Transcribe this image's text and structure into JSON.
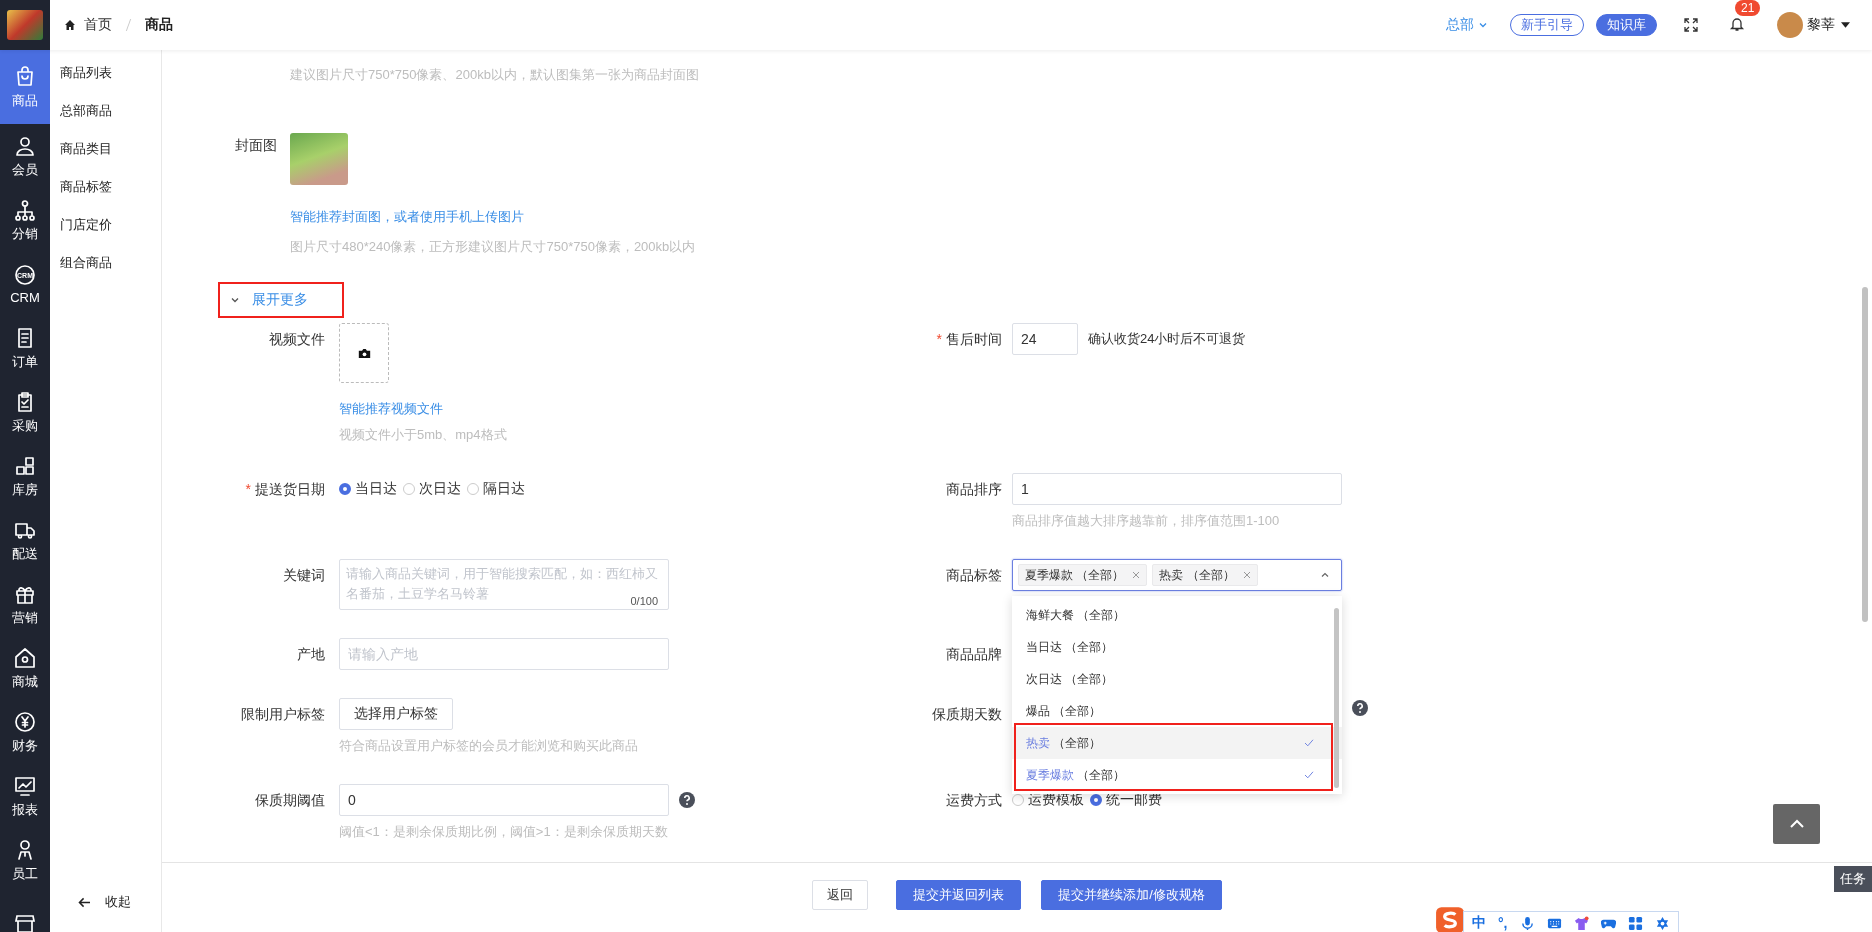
{
  "topbar": {
    "breadcrumb": [
      {
        "label": "首页"
      },
      {
        "label": "商品"
      }
    ],
    "org_switch": "总部",
    "guide_button": "新手引导",
    "kb_button": "知识库",
    "notification_count": "21",
    "user_name": "黎莘"
  },
  "nav_rail": [
    {
      "label": "商品",
      "selected": true
    },
    {
      "label": "会员",
      "selected": false
    },
    {
      "label": "分销",
      "selected": false
    },
    {
      "label": "CRM",
      "selected": false,
      "icon_text": "CRM"
    },
    {
      "label": "订单",
      "selected": false
    },
    {
      "label": "采购",
      "selected": false
    },
    {
      "label": "库房",
      "selected": false
    },
    {
      "label": "配送",
      "selected": false
    },
    {
      "label": "营销",
      "selected": false
    },
    {
      "label": "商城",
      "selected": false
    },
    {
      "label": "财务",
      "selected": false
    },
    {
      "label": "报表",
      "selected": false
    },
    {
      "label": "员工",
      "selected": false
    }
  ],
  "submenu": {
    "items": [
      "商品列表",
      "总部商品",
      "商品类目",
      "商品标签",
      "门店定价",
      "组合商品"
    ],
    "collapse": "收起"
  },
  "form": {
    "gallery_hint": "建议图片尺寸750*750像素、200kb以内，默认图集第一张为商品封面图",
    "cover": {
      "label": "封面图",
      "link": "智能推荐封面图，或者使用手机上传图片",
      "hint": "图片尺寸480*240像素，正方形建议图片尺寸750*750像素，200kb以内"
    },
    "expand_toggle": "展开更多",
    "video": {
      "label": "视频文件",
      "link": "智能推荐视频文件",
      "hint": "视频文件小于5mb、mp4格式"
    },
    "after_sale": {
      "label": "售后时间",
      "required_mark": "*",
      "value": "24",
      "note": "确认收货24小时后不可退货"
    },
    "delivery": {
      "label": "提送货日期",
      "required_mark": "*",
      "options": [
        {
          "label": "当日达",
          "selected": true
        },
        {
          "label": "次日达",
          "selected": false
        },
        {
          "label": "隔日达",
          "selected": false
        }
      ]
    },
    "sort": {
      "label": "商品排序",
      "value": "1",
      "hint": "商品排序值越大排序越靠前，排序值范围1-100"
    },
    "keywords": {
      "label": "关键词",
      "placeholder": "请输入商品关键词，用于智能搜索匹配，如：西红柿又名番茄，土豆学名马铃薯",
      "counter": "0/100"
    },
    "tags": {
      "label": "商品标签",
      "expanded": true,
      "chips": [
        {
          "name": "夏季爆款",
          "scope": "（全部）"
        },
        {
          "name": "热卖",
          "scope": "（全部）"
        }
      ],
      "options": [
        {
          "name": "海鲜大餐",
          "scope": "（全部）",
          "selected": false
        },
        {
          "name": "当日达",
          "scope": "（全部）",
          "selected": false
        },
        {
          "name": "次日达",
          "scope": "（全部）",
          "selected": false
        },
        {
          "name": "爆品",
          "scope": "（全部）",
          "selected": false
        },
        {
          "name": "热卖",
          "scope": "（全部）",
          "selected": true
        },
        {
          "name": "夏季爆款",
          "scope": "（全部）",
          "selected": true
        }
      ]
    },
    "origin": {
      "label": "产地",
      "placeholder": "请输入产地"
    },
    "brand": {
      "label": "商品品牌"
    },
    "user_tags": {
      "label": "限制用户标签",
      "button": "选择用户标签",
      "hint": "符合商品设置用户标签的会员才能浏览和购买此商品"
    },
    "shelf_days": {
      "label": "保质期天数"
    },
    "shelf_threshold": {
      "label": "保质期阈值",
      "value": "0",
      "hint": "阈值<1：是剩余保质期比例，阈值>1：是剩余保质期天数"
    },
    "shipping": {
      "label": "运费方式",
      "options": [
        {
          "label": "运费模板",
          "selected": false
        },
        {
          "label": "统一邮费",
          "selected": true
        }
      ]
    }
  },
  "actions": [
    "返回",
    "提交并返回列表",
    "提交并继续添加/修改规格"
  ],
  "task_tab": "任务",
  "ime_toolbar": {
    "mode": "中",
    "punctuation": "°,"
  }
}
